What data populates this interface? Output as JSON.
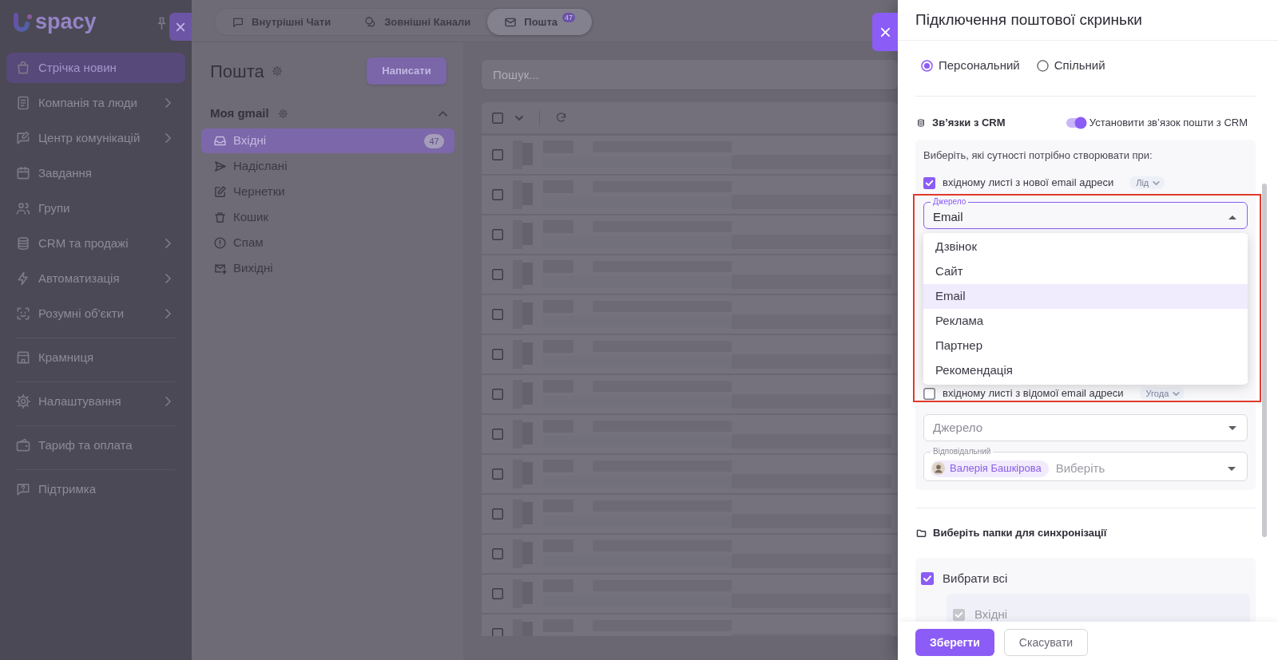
{
  "sidebar": {
    "logo_text": "spacy",
    "groups": [
      {
        "items": [
          {
            "label": "Стрічка новин",
            "selected": true,
            "expandable": false
          },
          {
            "label": "Компанія та люди",
            "selected": false,
            "expandable": true
          },
          {
            "label": "Центр комунікацій",
            "selected": false,
            "expandable": true
          },
          {
            "label": "Завдання",
            "selected": false,
            "expandable": false
          },
          {
            "label": "Групи",
            "selected": false,
            "expandable": false
          },
          {
            "label": "CRM та продажі",
            "selected": false,
            "expandable": true
          },
          {
            "label": "Автоматизація",
            "selected": false,
            "expandable": true
          },
          {
            "label": "Розумні об'єкти",
            "selected": false,
            "expandable": true
          }
        ]
      },
      {
        "items": [
          {
            "label": "Крамниця",
            "selected": false,
            "expandable": false
          }
        ]
      },
      {
        "items": [
          {
            "label": "Налаштування",
            "selected": false,
            "expandable": true
          }
        ]
      },
      {
        "items": [
          {
            "label": "Тариф та оплата",
            "selected": false,
            "expandable": false
          }
        ]
      },
      {
        "items": [
          {
            "label": "Підтримка",
            "selected": false,
            "expandable": false
          }
        ]
      }
    ]
  },
  "mail": {
    "tabs": [
      {
        "label": "Внутрішні Чати",
        "selected": false
      },
      {
        "label": "Зовнішні Канали",
        "selected": false
      },
      {
        "label": "Пошта",
        "selected": true,
        "badge": "47"
      }
    ],
    "title": "Пошта",
    "compose_button": "Написати",
    "account": {
      "name": "Моя gmail",
      "expanded": true
    },
    "folders": [
      {
        "label": "Вхідні",
        "selected": true,
        "count": "47"
      },
      {
        "label": "Надіслані",
        "selected": false
      },
      {
        "label": "Чернетки",
        "selected": false
      },
      {
        "label": "Кошик",
        "selected": false
      },
      {
        "label": "Спам",
        "selected": false
      },
      {
        "label": "Вихідні",
        "selected": false
      }
    ],
    "search": {
      "placeholder": "Пошук..."
    },
    "select_all": {
      "checked": false
    },
    "messages": [
      {
        "checked": false
      },
      {
        "checked": false
      },
      {
        "checked": false
      },
      {
        "checked": false
      },
      {
        "checked": false
      },
      {
        "checked": false
      },
      {
        "checked": false
      },
      {
        "checked": false
      },
      {
        "checked": false
      },
      {
        "checked": false
      },
      {
        "checked": false
      },
      {
        "checked": false
      },
      {
        "checked": false
      }
    ]
  },
  "dialog": {
    "title": "Підключення поштової скриньки",
    "mailbox_types": [
      {
        "label": "Персональний",
        "selected": true
      },
      {
        "label": "Спільний",
        "selected": false
      }
    ],
    "crm": {
      "heading": "Зв’язки з CRM",
      "toggle": {
        "label": "Установити зв’язок пошти з CRM",
        "on": true
      },
      "hint": "Виберіть, які сутності потрібно створювати при:",
      "rules": [
        {
          "label": "вхідному листі з нової email адреси",
          "checked": true,
          "entity": "Лід",
          "source": {
            "label": "Джерело",
            "value": "Email",
            "open": true,
            "highlighted": true,
            "options": [
              {
                "label": "Дзвінок",
                "selected": false
              },
              {
                "label": "Сайт",
                "selected": false
              },
              {
                "label": "Email",
                "selected": true
              },
              {
                "label": "Реклама",
                "selected": false
              },
              {
                "label": "Партнер",
                "selected": false
              },
              {
                "label": "Рекомендація",
                "selected": false
              }
            ]
          }
        },
        {
          "label": "вхідному листі з відомої email адреси",
          "checked": false,
          "entity": "Угода",
          "source": {
            "placeholder": "Джерело"
          },
          "responsible": {
            "label": "Відповідальний",
            "people": [
              {
                "name": "Валерія Башкірова"
              }
            ],
            "placeholder": "Виберіть"
          }
        }
      ]
    },
    "sync": {
      "heading": "Виберіть папки для синхронізації",
      "select_all": {
        "label": "Вибрати всі",
        "checked": true
      },
      "folders": [
        {
          "label": "Вхідні",
          "checked": true,
          "disabled": true
        }
      ]
    },
    "buttons": [
      {
        "label": "Зберегти",
        "kind": "primary"
      },
      {
        "label": "Скасувати",
        "kind": "secondary"
      }
    ]
  }
}
